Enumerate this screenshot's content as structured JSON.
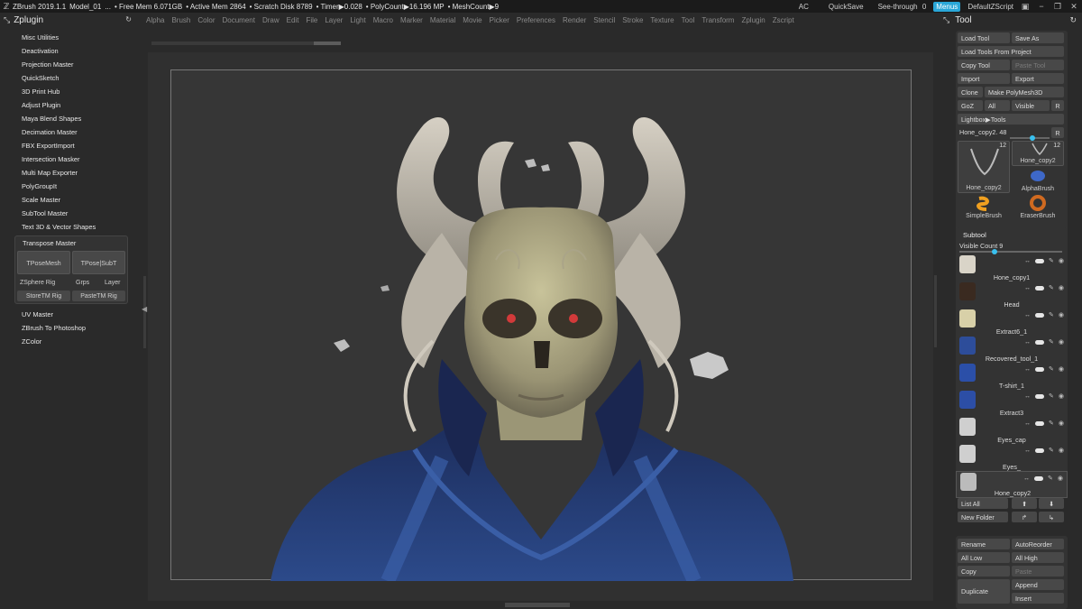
{
  "topbar": {
    "app": "ZBrush 2019.1.1",
    "model": "Model_01",
    "dots": "...",
    "free_mem": "• Free Mem 6.071GB",
    "active_mem": "• Active Mem 2864",
    "scratch": "• Scratch Disk 8789",
    "timer": "• Timer▶0.028",
    "polycount": "• PolyCount▶16.196 MP",
    "meshcount": "• MeshCount▶9",
    "ac": "AC",
    "quicksave": "QuickSave",
    "seethrough": "See-through",
    "seethrough_value": "0",
    "menus": "Menus",
    "script": "DefaultZScript"
  },
  "menu": [
    "Alpha",
    "Brush",
    "Color",
    "Document",
    "Draw",
    "Edit",
    "File",
    "Layer",
    "Light",
    "Macro",
    "Marker",
    "Material",
    "Movie",
    "Picker",
    "Preferences",
    "Render",
    "Stencil",
    "Stroke",
    "Texture",
    "Tool",
    "Transform",
    "Zplugin",
    "Zscript"
  ],
  "left": {
    "title": "Zplugin",
    "items_top": [
      "Misc Utilities",
      "Deactivation",
      "Projection Master",
      "QuickSketch",
      "3D Print Hub",
      "Adjust Plugin",
      "Maya Blend Shapes",
      "Decimation Master",
      "FBX ExportImport",
      "Intersection Masker",
      "Multi Map Exporter",
      "PolyGroupIt",
      "Scale Master",
      "SubTool Master",
      "Text 3D & Vector Shapes"
    ],
    "transpose": {
      "title": "Transpose Master",
      "btn1": "TPoseMesh",
      "btn2": "TPose|SubT",
      "zsphere": "ZSphere Rig",
      "grps": "Grps",
      "layer": "Layer",
      "store": "StoreTM Rig",
      "paste": "PasteTM Rig"
    },
    "items_bottom": [
      "UV Master",
      "ZBrush To Photoshop",
      "ZColor"
    ]
  },
  "right": {
    "title": "Tool",
    "load_tool": "Load Tool",
    "save_as": "Save As",
    "load_from_project": "Load Tools From Project",
    "copy_tool": "Copy Tool",
    "paste_tool": "Paste Tool",
    "import": "Import",
    "export": "Export",
    "clone": "Clone",
    "make_polymesh": "Make PolyMesh3D",
    "goz": "GoZ",
    "all": "All",
    "visible": "Visible",
    "r": "R",
    "lightbox": "Lightbox▶Tools",
    "tool_slider_label": "Hone_copy2.",
    "tool_slider_value": "48",
    "thumbs": [
      {
        "label": "Hone_copy2",
        "num": "12"
      },
      {
        "label": "Hone_copy2",
        "num": "12"
      },
      {
        "label": "AlphaBrush",
        "num": ""
      },
      {
        "label": "SimpleBrush",
        "num": ""
      },
      {
        "label": "EraserBrush",
        "num": ""
      }
    ],
    "subtool_title": "Subtool",
    "visible_count": "Visible Count 9",
    "subtools": [
      "Hone_copy1",
      "Head",
      "Extract6_1",
      "Recovered_tool_1",
      "T-shirt_1",
      "Extract3",
      "Eyes_cap",
      "Eyes_",
      "Hone_copy2"
    ],
    "list_all": "List All",
    "new_folder": "New Folder",
    "rename": "Rename",
    "autoreorder": "AutoReorder",
    "all_low": "All Low",
    "all_high": "All High",
    "copy": "Copy",
    "paste": "Paste",
    "duplicate": "Duplicate",
    "append": "Append",
    "insert": "Insert"
  }
}
